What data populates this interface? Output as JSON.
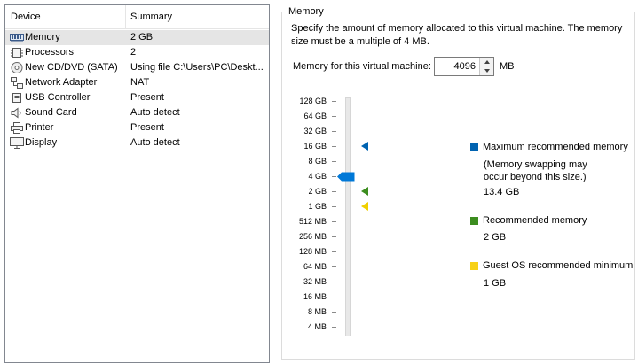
{
  "device_list": {
    "columns": {
      "device": "Device",
      "summary": "Summary"
    },
    "items": [
      {
        "icon": "memory-icon",
        "name": "Memory",
        "summary": "2 GB",
        "selected": true
      },
      {
        "icon": "processor-icon",
        "name": "Processors",
        "summary": "2",
        "selected": false
      },
      {
        "icon": "cd-dvd-icon",
        "name": "New CD/DVD (SATA)",
        "summary": "Using file C:\\Users\\PC\\Deskt...",
        "selected": false
      },
      {
        "icon": "network-adapter-icon",
        "name": "Network Adapter",
        "summary": "NAT",
        "selected": false
      },
      {
        "icon": "usb-controller-icon",
        "name": "USB Controller",
        "summary": "Present",
        "selected": false
      },
      {
        "icon": "sound-card-icon",
        "name": "Sound Card",
        "summary": "Auto detect",
        "selected": false
      },
      {
        "icon": "printer-icon",
        "name": "Printer",
        "summary": "Present",
        "selected": false
      },
      {
        "icon": "display-icon",
        "name": "Display",
        "summary": "Auto detect",
        "selected": false
      }
    ]
  },
  "memory": {
    "group_title": "Memory",
    "description": "Specify the amount of memory allocated to this virtual machine. The memory size must be a multiple of 4 MB.",
    "field_label": "Memory for this virtual machine:",
    "value": "4096",
    "unit": "MB",
    "scale_labels": [
      "128 GB",
      "64 GB",
      "32 GB",
      "16 GB",
      "8 GB",
      "4 GB",
      "2 GB",
      "1 GB",
      "512 MB",
      "256 MB",
      "128 MB",
      "64 MB",
      "32 MB",
      "16 MB",
      "8 MB",
      "4 MB"
    ],
    "slider_value": "4 GB",
    "markers": [
      {
        "name": "maximum",
        "at": "16 GB",
        "color": "#0063b1"
      },
      {
        "name": "recommended",
        "at": "2 GB",
        "color": "#3c8d1f"
      },
      {
        "name": "guest-os-minimum",
        "at": "1 GB",
        "color": "#f0d000"
      }
    ],
    "legend": {
      "maximum": {
        "title": "Maximum recommended memory",
        "note": "(Memory swapping may occur beyond this size.)",
        "value": "13.4 GB",
        "color": "#0063b1"
      },
      "recommended": {
        "title": "Recommended memory",
        "value": "2 GB",
        "color": "#3c8d1f"
      },
      "guest_minimum": {
        "title": "Guest OS recommended minimum",
        "value": "1 GB",
        "color": "#f7d117"
      }
    }
  }
}
